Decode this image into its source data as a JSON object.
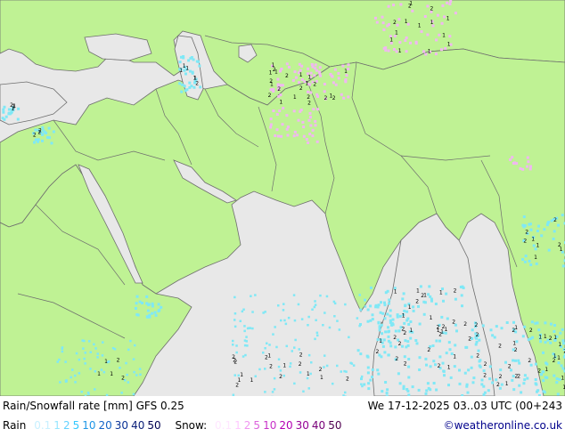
{
  "title": "Rain/Snowfall rate [mm] GFS 0.25",
  "valid_time": "We 17-12-2025 03..03 UTC (00+243",
  "legend": {
    "rain_label": "Rain",
    "rain_scale": [
      {
        "label": "0.1",
        "color": "#c8f0ff"
      },
      {
        "label": "1",
        "color": "#96e6ff"
      },
      {
        "label": "2",
        "color": "#64d2ff"
      },
      {
        "label": "5",
        "color": "#32c8ff"
      },
      {
        "label": "10",
        "color": "#1e96e6"
      },
      {
        "label": "20",
        "color": "#1464c8"
      },
      {
        "label": "30",
        "color": "#0a3296"
      },
      {
        "label": "40",
        "color": "#0a1e78"
      },
      {
        "label": "50",
        "color": "#000050"
      }
    ],
    "snow_label": "Snow:",
    "snow_scale": [
      {
        "label": "0.1",
        "color": "#ffe6ff"
      },
      {
        "label": "1",
        "color": "#ffc8ff"
      },
      {
        "label": "2",
        "color": "#f096f0"
      },
      {
        "label": "5",
        "color": "#dc64dc"
      },
      {
        "label": "10",
        "color": "#c832c8"
      },
      {
        "label": "20",
        "color": "#b400b4"
      },
      {
        "label": "30",
        "color": "#960096"
      },
      {
        "label": "40",
        "color": "#780078"
      },
      {
        "label": "50",
        "color": "#500050"
      }
    ]
  },
  "credit": "©weatheronline.co.uk",
  "colors": {
    "land": "#bff294",
    "sea": "#e8e8e8",
    "border": "#6e6e6e",
    "rain": "#7fe8f6",
    "snow": "#f0b8f0"
  },
  "cell_labels": [
    "1",
    "2",
    "3",
    "4"
  ]
}
